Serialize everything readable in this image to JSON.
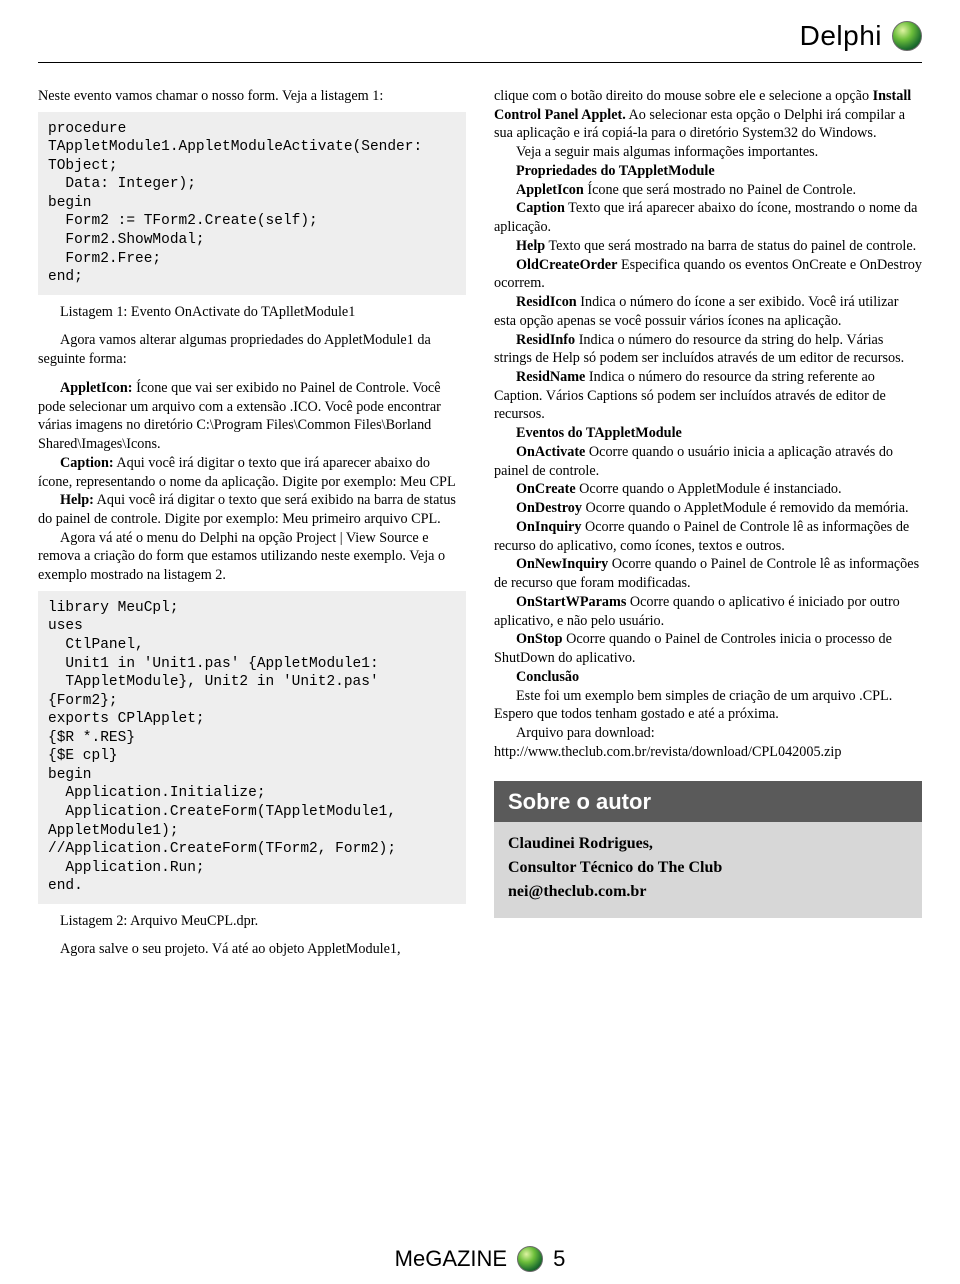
{
  "header": {
    "section": "Delphi"
  },
  "left": {
    "intro": "Neste evento vamos chamar o nosso form. Veja a listagem 1:",
    "code1": "procedure\nTAppletModule1.AppletModuleActivate(Sender:\nTObject;\n  Data: Integer);\nbegin\n  Form2 := TForm2.Create(self);\n  Form2.ShowModal;\n  Form2.Free;\nend;",
    "listing1": "Listagem 1: Evento OnActivate do TAplletModule1",
    "p1": "Agora vamos alterar algumas propriedades do AppletModule1 da seguinte forma:",
    "p2a": "AppletIcon:",
    "p2b": " Ícone que vai ser exibido no Painel de Controle. Você pode selecionar um arquivo com a extensão .ICO. Você pode encontrar várias imagens no diretório C:\\Program Files\\Common Files\\Borland Shared\\Images\\Icons.",
    "p3a": "Caption:",
    "p3b": " Aqui você irá digitar o texto que irá aparecer abaixo do ícone, representando o nome da aplicação. Digite por exemplo: Meu CPL",
    "p4a": "Help:",
    "p4b": " Aqui você irá digitar o texto que será exibido na barra de status do painel de controle. Digite por exemplo: Meu primeiro arquivo CPL.",
    "p5": "Agora vá até o menu do Delphi na opção Project | View Source e remova a criação do form que estamos utilizando neste exemplo. Veja o exemplo mostrado na listagem 2.",
    "code2": "library MeuCpl;\nuses\n  CtlPanel,\n  Unit1 in 'Unit1.pas' {AppletModule1:\n  TAppletModule}, Unit2 in 'Unit2.pas'\n{Form2};\nexports CPlApplet;\n{$R *.RES}\n{$E cpl}\nbegin\n  Application.Initialize;\n  Application.CreateForm(TAppletModule1,\nAppletModule1);\n//Application.CreateForm(TForm2, Form2);\n  Application.Run;\nend.",
    "listing2": "Listagem 2: Arquivo MeuCPL.dpr.",
    "p6": "Agora salve o seu projeto. Vá até ao objeto AppletModule1,"
  },
  "right": {
    "p1a": "clique com o botão direito do mouse sobre ele e selecione a opção ",
    "p1b": "Install Control Panel Applet.",
    "p1c": " Ao selecionar esta opção o Delphi irá compilar a sua aplicação e irá copiá-la para o diretório System32 do Windows.",
    "p2": "Veja a seguir mais algumas informações importantes.",
    "h1": "Propriedades do TAppletModule",
    "prop1a": "AppletIcon",
    "prop1b": " Ícone que será mostrado no Painel de Controle.",
    "prop2a": "Caption",
    "prop2b": " Texto que irá aparecer abaixo do ícone, mostrando o nome da aplicação.",
    "prop3a": "Help",
    "prop3b": " Texto que será mostrado na barra de status do painel de controle.",
    "prop4a": "OldCreateOrder",
    "prop4b": " Especifica quando os eventos OnCreate e OnDestroy ocorrem.",
    "prop5a": "ResidIcon",
    "prop5b": " Indica o número do ícone a ser exibido. Você irá utilizar esta opção apenas se você possuir vários ícones na aplicação.",
    "prop6a": "ResidInfo",
    "prop6b": " Indica o número do resource da string do help. Várias strings de Help só podem ser incluídos através de um editor de recursos.",
    "prop7a": "ResidName",
    "prop7b": " Indica o número do resource da string referente ao Caption. Vários Captions só podem ser incluídos através de editor de recursos.",
    "h2": "Eventos do TAppletModule",
    "ev1a": "OnActivate",
    "ev1b": " Ocorre quando o usuário inicia a aplicação através do painel de controle.",
    "ev2a": "OnCreate",
    "ev2b": " Ocorre quando o AppletModule é instanciado.",
    "ev3a": "OnDestroy",
    "ev3b": " Ocorre quando o AppletModule é removido da memória.",
    "ev4a": "OnInquiry",
    "ev4b": " Ocorre quando o Painel de Controle lê as informações de recurso do aplicativo, como ícones, textos e outros.",
    "ev5a": "OnNewInquiry",
    "ev5b": " Ocorre quando o Painel de Controle lê as informações de recurso que foram modificadas.",
    "ev6a": "OnStartWParams",
    "ev6b": " Ocorre quando o aplicativo é iniciado por outro aplicativo, e não pelo usuário.",
    "ev7a": "OnStop",
    "ev7b": " Ocorre quando o Painel de Controles inicia o processo de ShutDown do aplicativo.",
    "h3": "Conclusão",
    "c1": "Este foi um exemplo bem simples de criação de um arquivo .CPL. Espero que todos tenham gostado e até a próxima.",
    "c2": "Arquivo para download: http://www.theclub.com.br/revista/download/CPL042005.zip",
    "author_hd": "Sobre o autor",
    "author_name": "Claudinei Rodrigues,",
    "author_role": "Consultor Técnico do The Club",
    "author_mail": "nei@theclub.com.br"
  },
  "footer": {
    "mag": "MeGAZINE",
    "page": "5"
  }
}
